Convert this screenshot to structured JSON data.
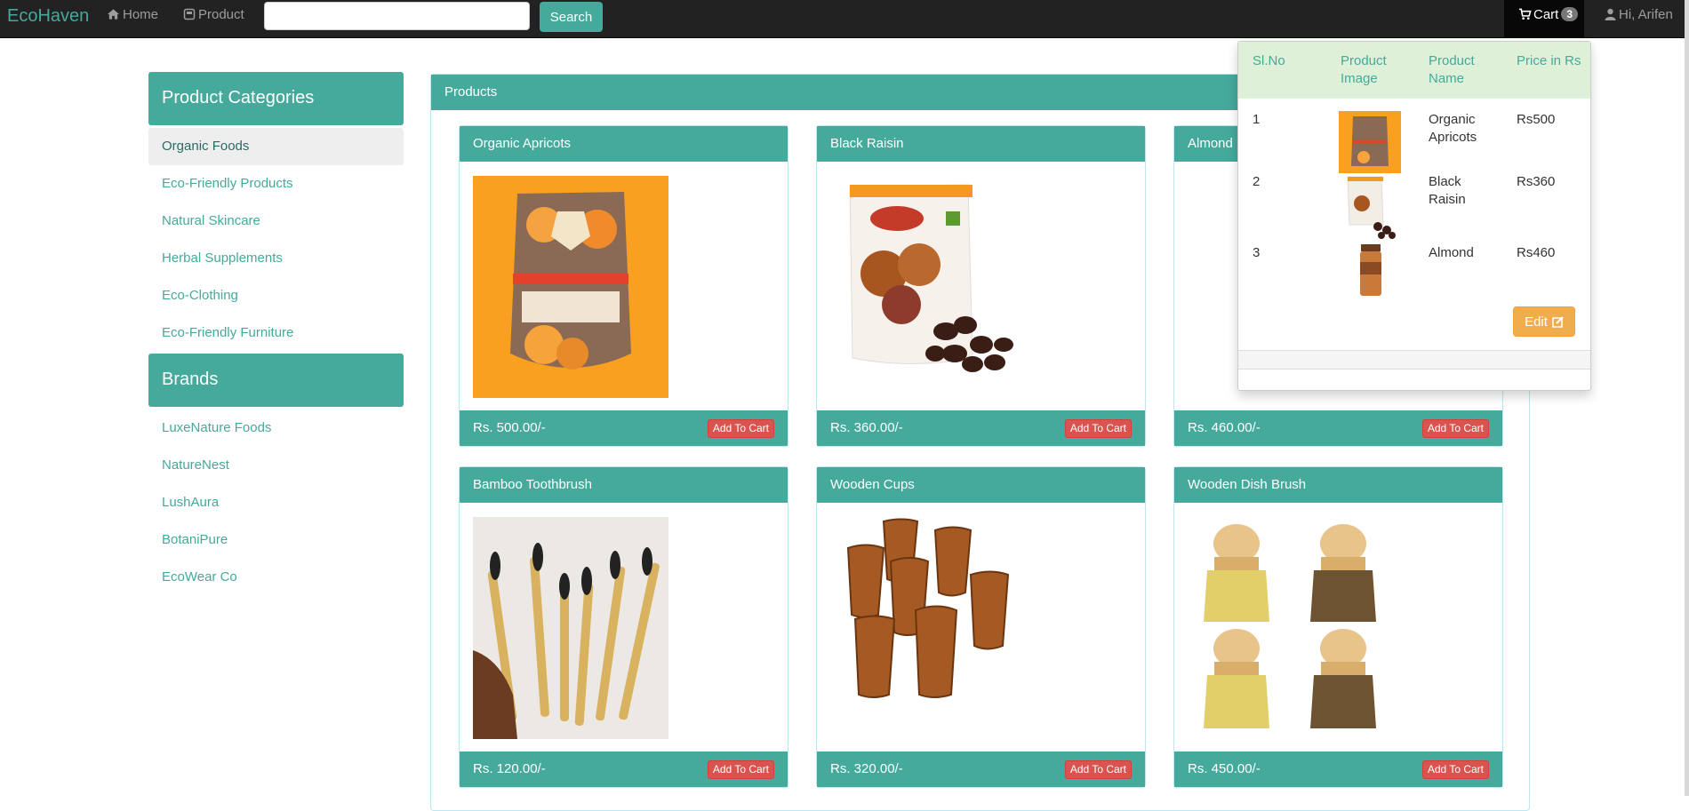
{
  "navbar": {
    "brand": "EcoHaven",
    "home_label": "Home",
    "product_label": "Product",
    "search_value": "",
    "search_button": "Search",
    "cart_label": "Cart",
    "cart_count": "3",
    "user_greeting": "Hi, Arifen"
  },
  "sidebar": {
    "categories_title": "Product Categories",
    "categories": [
      "Organic Foods",
      "Eco-Friendly Products",
      "Natural Skincare",
      "Herbal Supplements",
      "Eco-Clothing",
      "Eco-Friendly Furniture"
    ],
    "active_category": "Organic Foods",
    "brands_title": "Brands",
    "brands": [
      "LuxeNature Foods",
      "NatureNest",
      "LushAura",
      "BotaniPure",
      "EcoWear Co"
    ]
  },
  "products_panel": {
    "title": "Products",
    "add_to_cart_label": "Add To Cart",
    "items": [
      {
        "name": "Organic Apricots",
        "price": "Rs. 500.00/-",
        "image": "apricot-pack-image"
      },
      {
        "name": "Black Raisin",
        "price": "Rs. 360.00/-",
        "image": "raisin-pack-image"
      },
      {
        "name": "Almond",
        "price": "Rs. 460.00/-",
        "image": "almond-jar-image"
      },
      {
        "name": "Bamboo Toothbrush",
        "price": "Rs. 120.00/-",
        "image": "toothbrush-image"
      },
      {
        "name": "Wooden Cups",
        "price": "Rs. 320.00/-",
        "image": "wooden-cups-image"
      },
      {
        "name": "Wooden Dish Brush",
        "price": "Rs. 450.00/-",
        "image": "dish-brush-image"
      }
    ]
  },
  "cart_dropdown": {
    "headers": {
      "sl": "Sl.No",
      "image_1": "Product",
      "image_2": "Image",
      "name_1": "Product",
      "name_2": "Name",
      "price": "Price in Rs"
    },
    "rows": [
      {
        "sl": "1",
        "name_1": "Organic",
        "name_2": "Apricots",
        "price": "Rs500"
      },
      {
        "sl": "2",
        "name_1": "Black",
        "name_2": "Raisin",
        "price": "Rs360"
      },
      {
        "sl": "3",
        "name_1": "Almond",
        "name_2": "",
        "price": "Rs460"
      }
    ],
    "edit_label": "Edit"
  },
  "colors": {
    "accent": "#45a99b",
    "navbar": "#222222",
    "danger": "#d9534f",
    "warning": "#f0ad4e",
    "table_head": "#dff0d8"
  }
}
